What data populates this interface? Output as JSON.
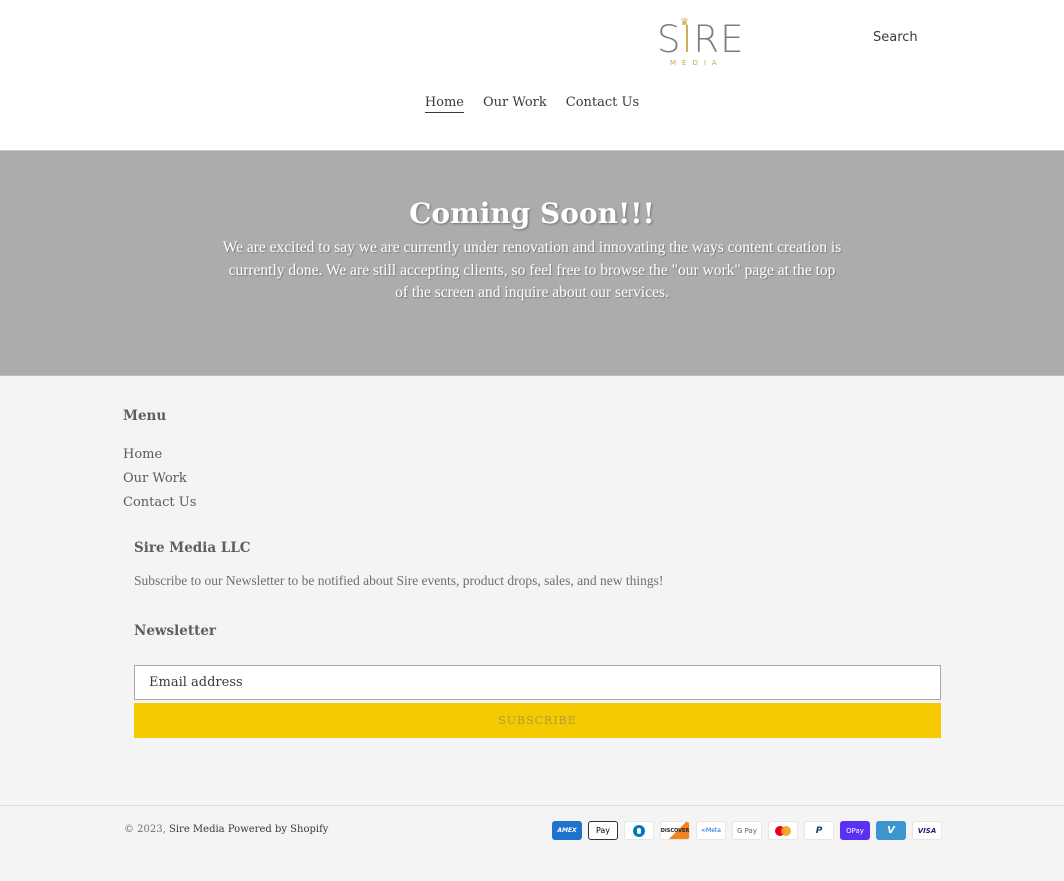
{
  "header": {
    "logo": {
      "main_prefix": "S",
      "main_accent": "I",
      "main_suffix": "RE",
      "crown": "♛",
      "sub": "MEDIA"
    },
    "search_label": "Search",
    "nav": [
      {
        "label": "Home",
        "active": true
      },
      {
        "label": "Our Work",
        "active": false
      },
      {
        "label": "Contact Us",
        "active": false
      }
    ]
  },
  "hero": {
    "title": "Coming Soon!!!",
    "text": "We are excited to say we are currently under renovation and innovating the ways content creation is currently done. We are still accepting clients, so feel free to browse the \"our work\" page at the top of the screen and inquire about our services."
  },
  "footer": {
    "menu": {
      "title": "Menu",
      "items": [
        "Home",
        "Our Work",
        "Contact Us"
      ]
    },
    "company": {
      "title": "Sire Media LLC",
      "description": "Subscribe to our Newsletter to be notified about Sire events, product drops, sales, and new things!"
    },
    "newsletter": {
      "title": "Newsletter",
      "email_placeholder": "Email address",
      "subscribe_label": "SUBSCRIBE"
    },
    "copyright": {
      "prefix": "© 2023,",
      "brand": "Sire Media",
      "powered": "Powered by Shopify"
    },
    "payment_methods": [
      {
        "name": "American Express",
        "label": "AMEX"
      },
      {
        "name": "Apple Pay",
        "label": " Pay"
      },
      {
        "name": "Diners Club",
        "label": ""
      },
      {
        "name": "Discover",
        "label": "DISCOVER"
      },
      {
        "name": "Meta Pay",
        "label": "∞Meta"
      },
      {
        "name": "Google Pay",
        "label": "G Pay"
      },
      {
        "name": "Mastercard",
        "label": ""
      },
      {
        "name": "PayPal",
        "label": "P"
      },
      {
        "name": "Shop Pay",
        "label": "OPay"
      },
      {
        "name": "Venmo",
        "label": "V"
      },
      {
        "name": "Visa",
        "label": "VISA"
      }
    ]
  },
  "colors": {
    "hero_bg": "#abacad",
    "footer_bg": "#f4f4f4",
    "subscribe_bg": "#f6ca00",
    "logo_gold": "#c9a94a"
  }
}
